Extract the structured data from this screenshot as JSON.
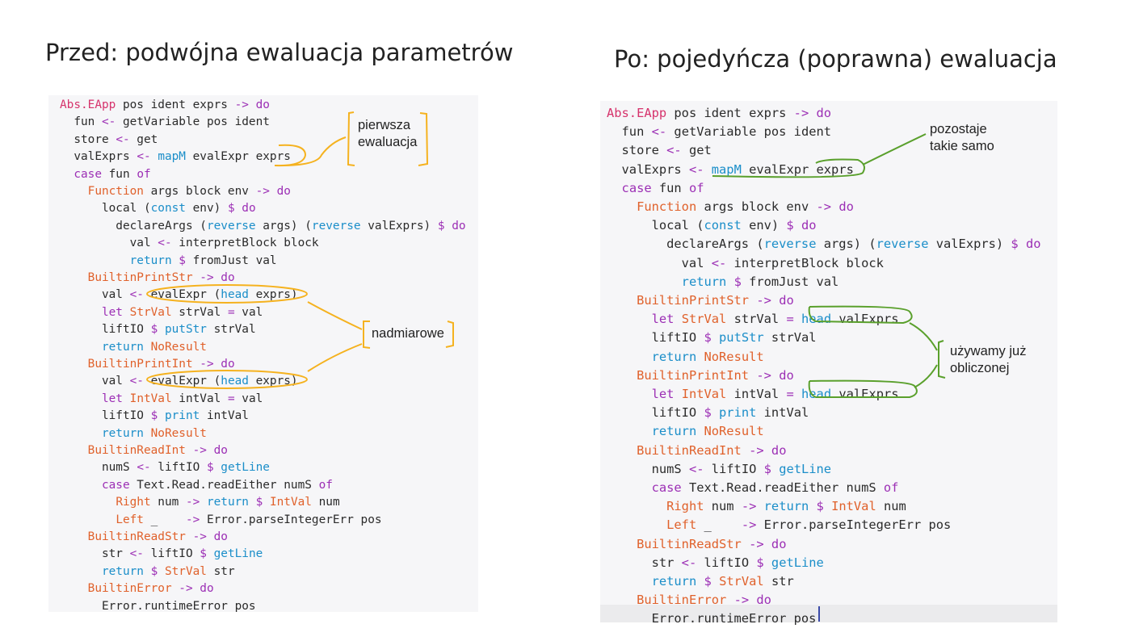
{
  "titles": {
    "left": "Przed: podwójna ewaluacja parametrów",
    "right": "Po: pojedyńcza (poprawna) ewaluacja"
  },
  "colors": {
    "keyword_pink": "#d6336c",
    "operator_purple": "#9c2fb5",
    "function_blue": "#1b8ec9",
    "constructor_orange": "#e0612b",
    "annotation_yellow": "#f5b21f",
    "annotation_green": "#5aa02c"
  },
  "left_code": [
    [
      [
        "tk-pink",
        "Abs.EApp"
      ],
      [
        "tk-plain",
        " pos ident exprs "
      ],
      [
        "tk-purple",
        "->"
      ],
      [
        "tk-plain",
        " "
      ],
      [
        "tk-purple",
        "do"
      ]
    ],
    [
      [
        "tk-plain",
        "  fun "
      ],
      [
        "tk-purple",
        "<-"
      ],
      [
        "tk-plain",
        " getVariable pos ident"
      ]
    ],
    [
      [
        "tk-plain",
        "  store "
      ],
      [
        "tk-purple",
        "<-"
      ],
      [
        "tk-plain",
        " get"
      ]
    ],
    [
      [
        "tk-plain",
        "  valExprs "
      ],
      [
        "tk-purple",
        "<-"
      ],
      [
        "tk-plain",
        " "
      ],
      [
        "tk-blue",
        "mapM"
      ],
      [
        "tk-plain",
        " evalExpr exprs"
      ]
    ],
    [
      [
        "tk-plain",
        "  "
      ],
      [
        "tk-purple",
        "case"
      ],
      [
        "tk-plain",
        " fun "
      ],
      [
        "tk-purple",
        "of"
      ]
    ],
    [
      [
        "tk-plain",
        "    "
      ],
      [
        "tk-orange",
        "Function"
      ],
      [
        "tk-plain",
        " args block env "
      ],
      [
        "tk-purple",
        "->"
      ],
      [
        "tk-plain",
        " "
      ],
      [
        "tk-purple",
        "do"
      ]
    ],
    [
      [
        "tk-plain",
        "      local ("
      ],
      [
        "tk-blue",
        "const"
      ],
      [
        "tk-plain",
        " env) "
      ],
      [
        "tk-purple",
        "$"
      ],
      [
        "tk-plain",
        " "
      ],
      [
        "tk-purple",
        "do"
      ]
    ],
    [
      [
        "tk-plain",
        "        declareArgs ("
      ],
      [
        "tk-blue",
        "reverse"
      ],
      [
        "tk-plain",
        " args) ("
      ],
      [
        "tk-blue",
        "reverse"
      ],
      [
        "tk-plain",
        " valExprs) "
      ],
      [
        "tk-purple",
        "$"
      ],
      [
        "tk-plain",
        " "
      ],
      [
        "tk-purple",
        "do"
      ]
    ],
    [
      [
        "tk-plain",
        "          val "
      ],
      [
        "tk-purple",
        "<-"
      ],
      [
        "tk-plain",
        " interpretBlock block"
      ]
    ],
    [
      [
        "tk-plain",
        "          "
      ],
      [
        "tk-blue",
        "return"
      ],
      [
        "tk-plain",
        " "
      ],
      [
        "tk-purple",
        "$"
      ],
      [
        "tk-plain",
        " fromJust val"
      ]
    ],
    [
      [
        "tk-plain",
        "    "
      ],
      [
        "tk-orange",
        "BuiltinPrintStr"
      ],
      [
        "tk-plain",
        " "
      ],
      [
        "tk-purple",
        "->"
      ],
      [
        "tk-plain",
        " "
      ],
      [
        "tk-purple",
        "do"
      ]
    ],
    [
      [
        "tk-plain",
        "      val "
      ],
      [
        "tk-purple",
        "<-"
      ],
      [
        "tk-plain",
        " evalExpr ("
      ],
      [
        "tk-blue",
        "head"
      ],
      [
        "tk-plain",
        " exprs)"
      ]
    ],
    [
      [
        "tk-plain",
        "      "
      ],
      [
        "tk-purple",
        "let"
      ],
      [
        "tk-plain",
        " "
      ],
      [
        "tk-orange",
        "StrVal"
      ],
      [
        "tk-plain",
        " strVal "
      ],
      [
        "tk-purple",
        "="
      ],
      [
        "tk-plain",
        " val"
      ]
    ],
    [
      [
        "tk-plain",
        "      liftIO "
      ],
      [
        "tk-purple",
        "$"
      ],
      [
        "tk-plain",
        " "
      ],
      [
        "tk-blue",
        "putStr"
      ],
      [
        "tk-plain",
        " strVal"
      ]
    ],
    [
      [
        "tk-plain",
        "      "
      ],
      [
        "tk-blue",
        "return"
      ],
      [
        "tk-plain",
        " "
      ],
      [
        "tk-orange",
        "NoResult"
      ]
    ],
    [
      [
        "tk-plain",
        "    "
      ],
      [
        "tk-orange",
        "BuiltinPrintInt"
      ],
      [
        "tk-plain",
        " "
      ],
      [
        "tk-purple",
        "->"
      ],
      [
        "tk-plain",
        " "
      ],
      [
        "tk-purple",
        "do"
      ]
    ],
    [
      [
        "tk-plain",
        "      val "
      ],
      [
        "tk-purple",
        "<-"
      ],
      [
        "tk-plain",
        " evalExpr ("
      ],
      [
        "tk-blue",
        "head"
      ],
      [
        "tk-plain",
        " exprs)"
      ]
    ],
    [
      [
        "tk-plain",
        "      "
      ],
      [
        "tk-purple",
        "let"
      ],
      [
        "tk-plain",
        " "
      ],
      [
        "tk-orange",
        "IntVal"
      ],
      [
        "tk-plain",
        " intVal "
      ],
      [
        "tk-purple",
        "="
      ],
      [
        "tk-plain",
        " val"
      ]
    ],
    [
      [
        "tk-plain",
        "      liftIO "
      ],
      [
        "tk-purple",
        "$"
      ],
      [
        "tk-plain",
        " "
      ],
      [
        "tk-blue",
        "print"
      ],
      [
        "tk-plain",
        " intVal"
      ]
    ],
    [
      [
        "tk-plain",
        "      "
      ],
      [
        "tk-blue",
        "return"
      ],
      [
        "tk-plain",
        " "
      ],
      [
        "tk-orange",
        "NoResult"
      ]
    ],
    [
      [
        "tk-plain",
        "    "
      ],
      [
        "tk-orange",
        "BuiltinReadInt"
      ],
      [
        "tk-plain",
        " "
      ],
      [
        "tk-purple",
        "->"
      ],
      [
        "tk-plain",
        " "
      ],
      [
        "tk-purple",
        "do"
      ]
    ],
    [
      [
        "tk-plain",
        "      numS "
      ],
      [
        "tk-purple",
        "<-"
      ],
      [
        "tk-plain",
        " liftIO "
      ],
      [
        "tk-purple",
        "$"
      ],
      [
        "tk-plain",
        " "
      ],
      [
        "tk-blue",
        "getLine"
      ]
    ],
    [
      [
        "tk-plain",
        "      "
      ],
      [
        "tk-purple",
        "case"
      ],
      [
        "tk-plain",
        " Text.Read.readEither numS "
      ],
      [
        "tk-purple",
        "of"
      ]
    ],
    [
      [
        "tk-plain",
        "        "
      ],
      [
        "tk-orange",
        "Right"
      ],
      [
        "tk-plain",
        " num "
      ],
      [
        "tk-purple",
        "->"
      ],
      [
        "tk-plain",
        " "
      ],
      [
        "tk-blue",
        "return"
      ],
      [
        "tk-plain",
        " "
      ],
      [
        "tk-purple",
        "$"
      ],
      [
        "tk-plain",
        " "
      ],
      [
        "tk-orange",
        "IntVal"
      ],
      [
        "tk-plain",
        " num"
      ]
    ],
    [
      [
        "tk-plain",
        "        "
      ],
      [
        "tk-orange",
        "Left"
      ],
      [
        "tk-plain",
        " _    "
      ],
      [
        "tk-purple",
        "->"
      ],
      [
        "tk-plain",
        " Error.parseIntegerErr pos"
      ]
    ],
    [
      [
        "tk-plain",
        "    "
      ],
      [
        "tk-orange",
        "BuiltinReadStr"
      ],
      [
        "tk-plain",
        " "
      ],
      [
        "tk-purple",
        "->"
      ],
      [
        "tk-plain",
        " "
      ],
      [
        "tk-purple",
        "do"
      ]
    ],
    [
      [
        "tk-plain",
        "      str "
      ],
      [
        "tk-purple",
        "<-"
      ],
      [
        "tk-plain",
        " liftIO "
      ],
      [
        "tk-purple",
        "$"
      ],
      [
        "tk-plain",
        " "
      ],
      [
        "tk-blue",
        "getLine"
      ]
    ],
    [
      [
        "tk-plain",
        "      "
      ],
      [
        "tk-blue",
        "return"
      ],
      [
        "tk-plain",
        " "
      ],
      [
        "tk-purple",
        "$"
      ],
      [
        "tk-plain",
        " "
      ],
      [
        "tk-orange",
        "StrVal"
      ],
      [
        "tk-plain",
        " str"
      ]
    ],
    [
      [
        "tk-plain",
        "    "
      ],
      [
        "tk-orange",
        "BuiltinError"
      ],
      [
        "tk-plain",
        " "
      ],
      [
        "tk-purple",
        "->"
      ],
      [
        "tk-plain",
        " "
      ],
      [
        "tk-purple",
        "do"
      ]
    ],
    [
      [
        "tk-plain",
        "      Error.runtimeError pos"
      ]
    ]
  ],
  "right_code": [
    [
      [
        "tk-pink",
        "Abs.EApp"
      ],
      [
        "tk-plain",
        " pos ident exprs "
      ],
      [
        "tk-purple",
        "->"
      ],
      [
        "tk-plain",
        " "
      ],
      [
        "tk-purple",
        "do"
      ]
    ],
    [
      [
        "tk-plain",
        "  fun "
      ],
      [
        "tk-purple",
        "<-"
      ],
      [
        "tk-plain",
        " getVariable pos ident"
      ]
    ],
    [
      [
        "tk-plain",
        "  store "
      ],
      [
        "tk-purple",
        "<-"
      ],
      [
        "tk-plain",
        " get"
      ]
    ],
    [
      [
        "tk-plain",
        "  valExprs "
      ],
      [
        "tk-purple",
        "<-"
      ],
      [
        "tk-plain",
        " "
      ],
      [
        "tk-blue",
        "mapM"
      ],
      [
        "tk-plain",
        " evalExpr exprs"
      ]
    ],
    [
      [
        "tk-plain",
        "  "
      ],
      [
        "tk-purple",
        "case"
      ],
      [
        "tk-plain",
        " fun "
      ],
      [
        "tk-purple",
        "of"
      ]
    ],
    [
      [
        "tk-plain",
        "    "
      ],
      [
        "tk-orange",
        "Function"
      ],
      [
        "tk-plain",
        " args block env "
      ],
      [
        "tk-purple",
        "->"
      ],
      [
        "tk-plain",
        " "
      ],
      [
        "tk-purple",
        "do"
      ]
    ],
    [
      [
        "tk-plain",
        "      local ("
      ],
      [
        "tk-blue",
        "const"
      ],
      [
        "tk-plain",
        " env) "
      ],
      [
        "tk-purple",
        "$"
      ],
      [
        "tk-plain",
        " "
      ],
      [
        "tk-purple",
        "do"
      ]
    ],
    [
      [
        "tk-plain",
        "        declareArgs ("
      ],
      [
        "tk-blue",
        "reverse"
      ],
      [
        "tk-plain",
        " args) ("
      ],
      [
        "tk-blue",
        "reverse"
      ],
      [
        "tk-plain",
        " valExprs) "
      ],
      [
        "tk-purple",
        "$"
      ],
      [
        "tk-plain",
        " "
      ],
      [
        "tk-purple",
        "do"
      ]
    ],
    [
      [
        "tk-plain",
        "          val "
      ],
      [
        "tk-purple",
        "<-"
      ],
      [
        "tk-plain",
        " interpretBlock block"
      ]
    ],
    [
      [
        "tk-plain",
        "          "
      ],
      [
        "tk-blue",
        "return"
      ],
      [
        "tk-plain",
        " "
      ],
      [
        "tk-purple",
        "$"
      ],
      [
        "tk-plain",
        " fromJust val"
      ]
    ],
    [
      [
        "tk-plain",
        "    "
      ],
      [
        "tk-orange",
        "BuiltinPrintStr"
      ],
      [
        "tk-plain",
        " "
      ],
      [
        "tk-purple",
        "->"
      ],
      [
        "tk-plain",
        " "
      ],
      [
        "tk-purple",
        "do"
      ]
    ],
    [
      [
        "tk-plain",
        "      "
      ],
      [
        "tk-purple",
        "let"
      ],
      [
        "tk-plain",
        " "
      ],
      [
        "tk-orange",
        "StrVal"
      ],
      [
        "tk-plain",
        " strVal "
      ],
      [
        "tk-purple",
        "="
      ],
      [
        "tk-plain",
        " "
      ],
      [
        "tk-blue",
        "head"
      ],
      [
        "tk-plain",
        " valExprs"
      ]
    ],
    [
      [
        "tk-plain",
        "      liftIO "
      ],
      [
        "tk-purple",
        "$"
      ],
      [
        "tk-plain",
        " "
      ],
      [
        "tk-blue",
        "putStr"
      ],
      [
        "tk-plain",
        " strVal"
      ]
    ],
    [
      [
        "tk-plain",
        "      "
      ],
      [
        "tk-blue",
        "return"
      ],
      [
        "tk-plain",
        " "
      ],
      [
        "tk-orange",
        "NoResult"
      ]
    ],
    [
      [
        "tk-plain",
        "    "
      ],
      [
        "tk-orange",
        "BuiltinPrintInt"
      ],
      [
        "tk-plain",
        " "
      ],
      [
        "tk-purple",
        "->"
      ],
      [
        "tk-plain",
        " "
      ],
      [
        "tk-purple",
        "do"
      ]
    ],
    [
      [
        "tk-plain",
        "      "
      ],
      [
        "tk-purple",
        "let"
      ],
      [
        "tk-plain",
        " "
      ],
      [
        "tk-orange",
        "IntVal"
      ],
      [
        "tk-plain",
        " intVal "
      ],
      [
        "tk-purple",
        "="
      ],
      [
        "tk-plain",
        " "
      ],
      [
        "tk-blue",
        "head"
      ],
      [
        "tk-plain",
        " valExprs"
      ]
    ],
    [
      [
        "tk-plain",
        "      liftIO "
      ],
      [
        "tk-purple",
        "$"
      ],
      [
        "tk-plain",
        " "
      ],
      [
        "tk-blue",
        "print"
      ],
      [
        "tk-plain",
        " intVal"
      ]
    ],
    [
      [
        "tk-plain",
        "      "
      ],
      [
        "tk-blue",
        "return"
      ],
      [
        "tk-plain",
        " "
      ],
      [
        "tk-orange",
        "NoResult"
      ]
    ],
    [
      [
        "tk-plain",
        "    "
      ],
      [
        "tk-orange",
        "BuiltinReadInt"
      ],
      [
        "tk-plain",
        " "
      ],
      [
        "tk-purple",
        "->"
      ],
      [
        "tk-plain",
        " "
      ],
      [
        "tk-purple",
        "do"
      ]
    ],
    [
      [
        "tk-plain",
        "      numS "
      ],
      [
        "tk-purple",
        "<-"
      ],
      [
        "tk-plain",
        " liftIO "
      ],
      [
        "tk-purple",
        "$"
      ],
      [
        "tk-plain",
        " "
      ],
      [
        "tk-blue",
        "getLine"
      ]
    ],
    [
      [
        "tk-plain",
        "      "
      ],
      [
        "tk-purple",
        "case"
      ],
      [
        "tk-plain",
        " Text.Read.readEither numS "
      ],
      [
        "tk-purple",
        "of"
      ]
    ],
    [
      [
        "tk-plain",
        "        "
      ],
      [
        "tk-orange",
        "Right"
      ],
      [
        "tk-plain",
        " num "
      ],
      [
        "tk-purple",
        "->"
      ],
      [
        "tk-plain",
        " "
      ],
      [
        "tk-blue",
        "return"
      ],
      [
        "tk-plain",
        " "
      ],
      [
        "tk-purple",
        "$"
      ],
      [
        "tk-plain",
        " "
      ],
      [
        "tk-orange",
        "IntVal"
      ],
      [
        "tk-plain",
        " num"
      ]
    ],
    [
      [
        "tk-plain",
        "        "
      ],
      [
        "tk-orange",
        "Left"
      ],
      [
        "tk-plain",
        " _    "
      ],
      [
        "tk-purple",
        "->"
      ],
      [
        "tk-plain",
        " Error.parseIntegerErr pos"
      ]
    ],
    [
      [
        "tk-plain",
        "    "
      ],
      [
        "tk-orange",
        "BuiltinReadStr"
      ],
      [
        "tk-plain",
        " "
      ],
      [
        "tk-purple",
        "->"
      ],
      [
        "tk-plain",
        " "
      ],
      [
        "tk-purple",
        "do"
      ]
    ],
    [
      [
        "tk-plain",
        "      str "
      ],
      [
        "tk-purple",
        "<-"
      ],
      [
        "tk-plain",
        " liftIO "
      ],
      [
        "tk-purple",
        "$"
      ],
      [
        "tk-plain",
        " "
      ],
      [
        "tk-blue",
        "getLine"
      ]
    ],
    [
      [
        "tk-plain",
        "      "
      ],
      [
        "tk-blue",
        "return"
      ],
      [
        "tk-plain",
        " "
      ],
      [
        "tk-purple",
        "$"
      ],
      [
        "tk-plain",
        " "
      ],
      [
        "tk-orange",
        "StrVal"
      ],
      [
        "tk-plain",
        " str"
      ]
    ],
    [
      [
        "tk-plain",
        "    "
      ],
      [
        "tk-orange",
        "BuiltinError"
      ],
      [
        "tk-plain",
        " "
      ],
      [
        "tk-purple",
        "->"
      ],
      [
        "tk-plain",
        " "
      ],
      [
        "tk-purple",
        "do"
      ]
    ],
    [
      [
        "tk-plain",
        "      Error.runtimeError pos"
      ]
    ]
  ],
  "annotations": {
    "left_first_eval": "pierwsza\newaluacja",
    "left_redundant": "nadmiarowe",
    "right_unchanged": "pozostaje\ntakie samo",
    "right_already_computed": "używamy już\nobliczonej"
  }
}
